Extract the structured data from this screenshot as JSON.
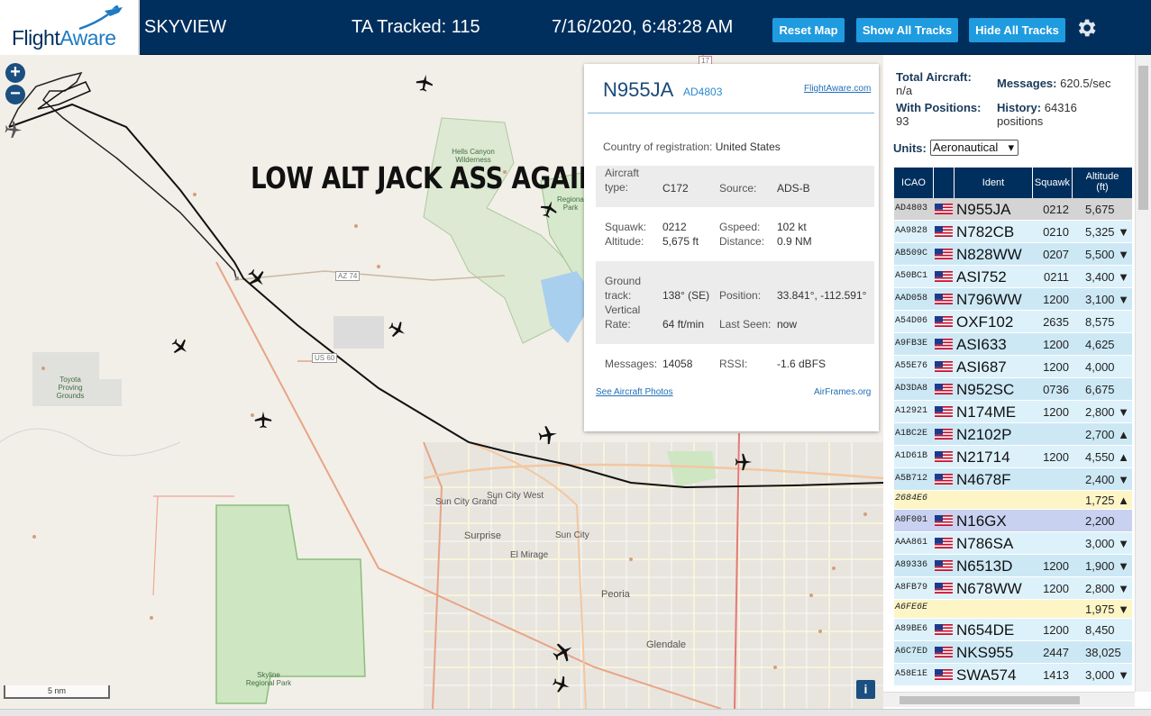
{
  "header": {
    "logo_flight": "Flight",
    "logo_aware": "Aware",
    "site_name": "SKYVIEW",
    "tracked_label": "TA Tracked: 115",
    "clock": "7/16/2020, 6:48:28 AM",
    "reset_label": "Reset Map",
    "show_label": "Show All Tracks",
    "hide_label": "Hide All Tracks"
  },
  "map": {
    "annotation": "LOW ALT JACK ASS AGAIN",
    "scale": "5 nm",
    "zoom_in": "+",
    "zoom_out": "−",
    "info": "i",
    "places": {
      "hells_canyon": "Hells Canyon Wilderness",
      "regional_park": "Regional Park",
      "toyota": "Toyota Proving Grounds",
      "sun_city_grand": "Sun City Grand",
      "sun_city_west": "Sun City West",
      "surprise": "Surprise",
      "el_mirage": "El Mirage",
      "sun_city": "Sun City",
      "peoria": "Peoria",
      "glendale": "Glendale",
      "skyline": "Skyline Regional Park",
      "az74": "AZ 74",
      "us60": "US 60",
      "r17": "17"
    }
  },
  "popup": {
    "ident": "N955JA",
    "icao": "AD4803",
    "fa_link": "FlightAware.com",
    "country_label": "Country of registration:",
    "country_value": "United States",
    "aircraft_label": "Aircraft type:",
    "aircraft_value": "C172",
    "source_label": "Source:",
    "source_value": "ADS-B",
    "squawk_label": "Squawk:",
    "squawk_value": "0212",
    "gspeed_label": "Gspeed:",
    "gspeed_value": "102 kt",
    "altitude_label": "Altitude:",
    "altitude_value": "5,675 ft",
    "distance_label": "Distance:",
    "distance_value": "0.9 NM",
    "ground_label": "Ground",
    "track_label": "track:",
    "track_value": "138° (SE)",
    "position_label": "Position:",
    "position_value": "33.841°, -112.591°",
    "vertical_label": "Vertical",
    "rate_label": "Rate:",
    "rate_value": "64 ft/min",
    "lastseen_label": "Last Seen:",
    "lastseen_value": "now",
    "messages_label": "Messages:",
    "messages_value": "14058",
    "rssi_label": "RSSI:",
    "rssi_value": "-1.6 dBFS",
    "photos_link": "See Aircraft Photos",
    "airframes_link": "AirFrames.org"
  },
  "sidebar": {
    "total_label": "Total Aircraft:",
    "total_value": "n/a",
    "messages_label": "Messages:",
    "messages_value": "620.5/sec",
    "positions_label": "With Positions:",
    "positions_value": "93",
    "history_label": "History:",
    "history_value": "64316",
    "history_unit": "positions",
    "units_label": "Units:",
    "units_value": "Aeronautical",
    "columns": {
      "icao": "ICAO",
      "ident": "Ident",
      "squawk": "Squawk",
      "alt1": "Altitude",
      "alt2": "(ft)"
    },
    "rows": [
      {
        "icao": "AD4803",
        "ident": "N955JA",
        "squawk": "0212",
        "alt": "5,675",
        "trend": ""
      },
      {
        "icao": "AA9828",
        "ident": "N782CB",
        "squawk": "0210",
        "alt": "5,325",
        "trend": "▼"
      },
      {
        "icao": "AB509C",
        "ident": "N828WW",
        "squawk": "0207",
        "alt": "5,500",
        "trend": "▼"
      },
      {
        "icao": "A50BC1",
        "ident": "ASI752",
        "squawk": "0211",
        "alt": "3,400",
        "trend": "▼"
      },
      {
        "icao": "AAD058",
        "ident": "N796WW",
        "squawk": "1200",
        "alt": "3,100",
        "trend": "▼"
      },
      {
        "icao": "A54D06",
        "ident": "OXF102",
        "squawk": "2635",
        "alt": "8,575",
        "trend": ""
      },
      {
        "icao": "A9FB3E",
        "ident": "ASI633",
        "squawk": "1200",
        "alt": "4,625",
        "trend": ""
      },
      {
        "icao": "A55E76",
        "ident": "ASI687",
        "squawk": "1200",
        "alt": "4,000",
        "trend": ""
      },
      {
        "icao": "AD3DA8",
        "ident": "N952SC",
        "squawk": "0736",
        "alt": "6,675",
        "trend": ""
      },
      {
        "icao": "A12921",
        "ident": "N174ME",
        "squawk": "1200",
        "alt": "2,800",
        "trend": "▼"
      },
      {
        "icao": "A1BC2E",
        "ident": "N2102P",
        "squawk": "",
        "alt": "2,700",
        "trend": "▲"
      },
      {
        "icao": "A1D61B",
        "ident": "N21714",
        "squawk": "1200",
        "alt": "4,550",
        "trend": "▲"
      },
      {
        "icao": "A5B712",
        "ident": "N4678F",
        "squawk": "",
        "alt": "2,400",
        "trend": "▼"
      },
      {
        "icao": "2684E6",
        "ident": "",
        "squawk": "",
        "alt": "1,725",
        "trend": "▲"
      },
      {
        "icao": "A0F001",
        "ident": "N16GX",
        "squawk": "",
        "alt": "2,200",
        "trend": ""
      },
      {
        "icao": "AAA861",
        "ident": "N786SA",
        "squawk": "",
        "alt": "3,000",
        "trend": "▼"
      },
      {
        "icao": "A89336",
        "ident": "N6513D",
        "squawk": "1200",
        "alt": "1,900",
        "trend": "▼"
      },
      {
        "icao": "A8FB79",
        "ident": "N678WW",
        "squawk": "1200",
        "alt": "2,800",
        "trend": "▼"
      },
      {
        "icao": "A6FE6E",
        "ident": "",
        "squawk": "",
        "alt": "1,975",
        "trend": "▼"
      },
      {
        "icao": "A89BE6",
        "ident": "N654DE",
        "squawk": "1200",
        "alt": "8,450",
        "trend": ""
      },
      {
        "icao": "A6C7ED",
        "ident": "NKS955",
        "squawk": "2447",
        "alt": "38,025",
        "trend": ""
      },
      {
        "icao": "A58E1E",
        "ident": "SWA574",
        "squawk": "1413",
        "alt": "3,000",
        "trend": "▼"
      }
    ]
  }
}
